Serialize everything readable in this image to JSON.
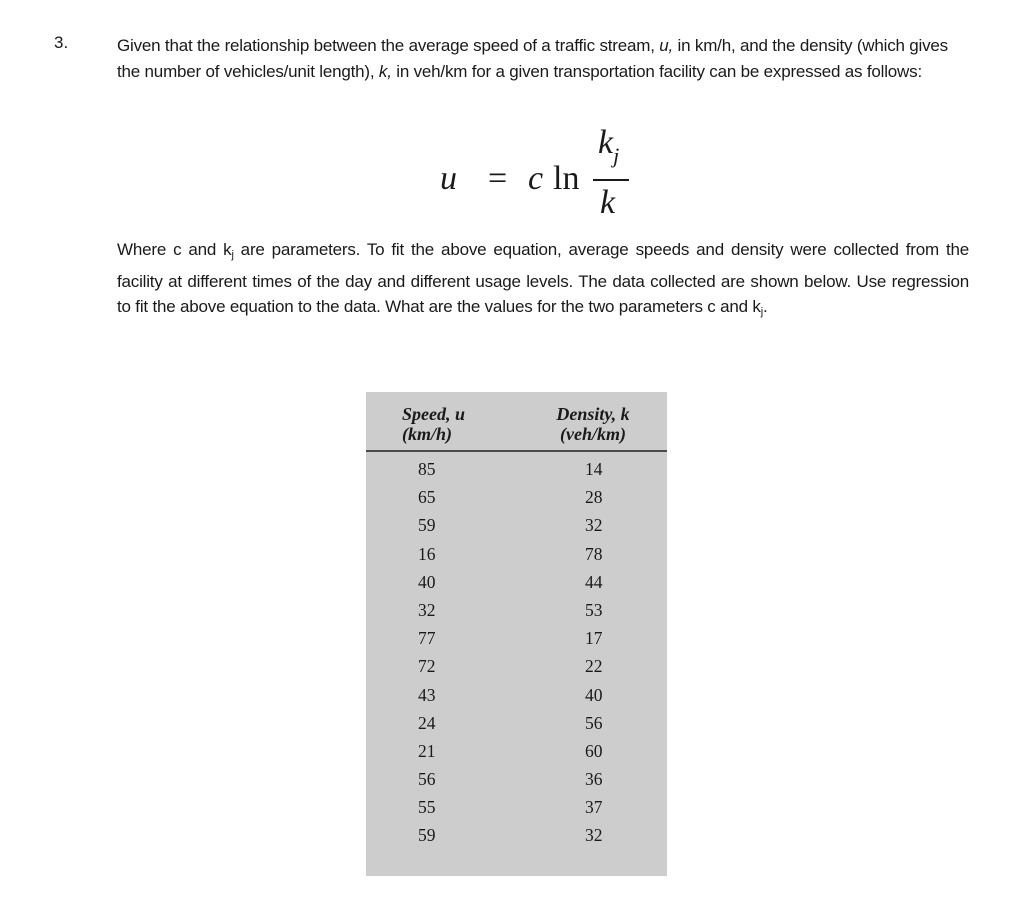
{
  "question": {
    "number": "3.",
    "intro": {
      "before_u": "Given that the relationship between the average speed of a traffic stream, ",
      "u": "u,",
      "between": " in km/h, and the density (which gives the number of vehicles/unit length), ",
      "k": "k,",
      "after_k": " in veh/km for a given transportation facility can be expressed as follows:"
    },
    "equation": {
      "lhs": "u",
      "equals": "=",
      "coef": "c",
      "func": "ln",
      "numerator": "k",
      "numerator_sub": "j",
      "denominator": "k"
    },
    "body": {
      "part1": "Where c and k",
      "sub1": "j",
      "part2": " are parameters. To fit the above equation, average speeds and density were collected from the facility at different times of the day and different usage levels. The data collected are shown below. Use regression to fit the above equation to the data. What are the values for the two parameters c and k",
      "sub2": "j",
      "part3": "."
    }
  },
  "table": {
    "headers": [
      {
        "line1": "Speed, u",
        "line2": "(km/h)"
      },
      {
        "line1": "Density, k",
        "line2": "(veh/km)"
      }
    ],
    "rows": [
      {
        "speed": "85",
        "density": "14"
      },
      {
        "speed": "65",
        "density": "28"
      },
      {
        "speed": "59",
        "density": "32"
      },
      {
        "speed": "16",
        "density": "78"
      },
      {
        "speed": "40",
        "density": "44"
      },
      {
        "speed": "32",
        "density": "53"
      },
      {
        "speed": "77",
        "density": "17"
      },
      {
        "speed": "72",
        "density": "22"
      },
      {
        "speed": "43",
        "density": "40"
      },
      {
        "speed": "24",
        "density": "56"
      },
      {
        "speed": "21",
        "density": "60"
      },
      {
        "speed": "56",
        "density": "36"
      },
      {
        "speed": "55",
        "density": "37"
      },
      {
        "speed": "59",
        "density": "32"
      }
    ]
  },
  "colors": {
    "table_background": "#cdcdcd",
    "rule": "#4a4a4a",
    "text": "#1a1a1a"
  }
}
